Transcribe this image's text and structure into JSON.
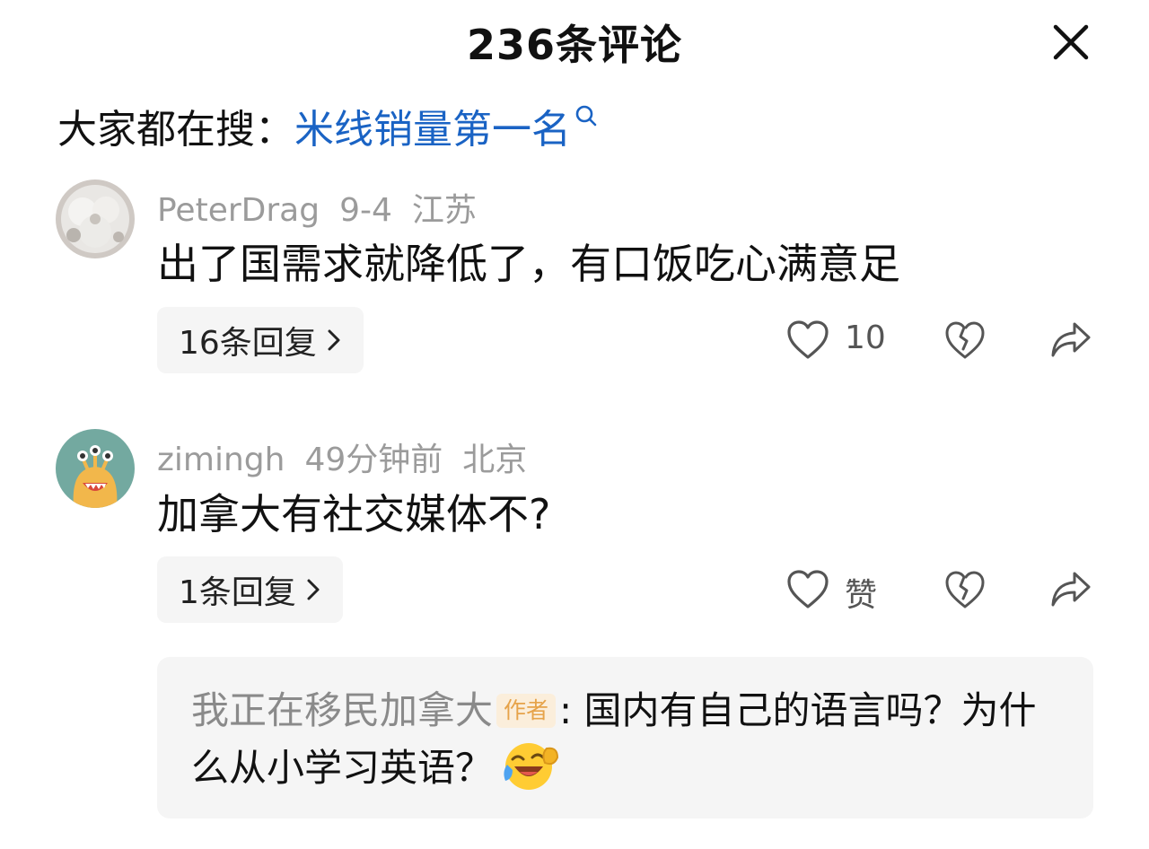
{
  "header": {
    "title": "236条评论"
  },
  "search": {
    "label": "大家都在搜：",
    "term": "米线销量第一名"
  },
  "comments": [
    {
      "username": "PeterDrag",
      "date": "9-4",
      "location": "江苏",
      "text": "出了国需求就降低了，有口饭吃心满意足",
      "reply_label": "16条回复",
      "like_count": "10"
    },
    {
      "username": "zimingh",
      "date": "49分钟前",
      "location": "北京",
      "text": "加拿大有社交媒体不?",
      "reply_label": "1条回复",
      "like_count": "赞",
      "sub_reply": {
        "author": "我正在移民加拿大",
        "badge": "作者",
        "text": ": 国内有自己的语言吗？为什么从小学习英语？",
        "emoji": "laughing-crying-emoji"
      }
    }
  ],
  "colors": {
    "link": "#1a63c4",
    "muted": "#9b9b9b",
    "badge_text": "#e6a34a",
    "panel": "#f5f5f5"
  }
}
